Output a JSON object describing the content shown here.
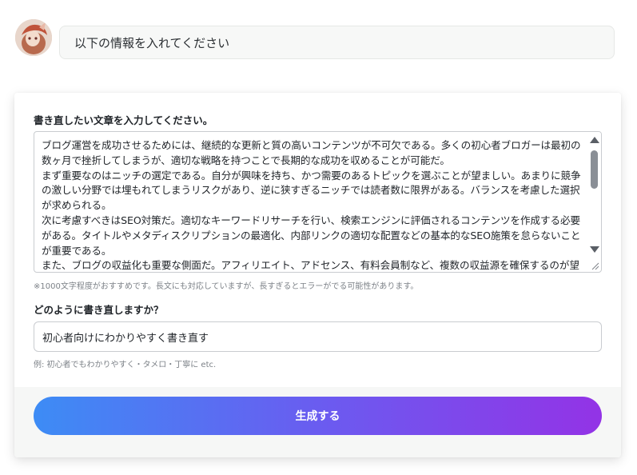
{
  "chat": {
    "user_prompt": "以下の情報を入れてください"
  },
  "form": {
    "article_label": "書き直したい文章を入力してください。",
    "article_text": "ブログ運営を成功させるためには、継続的な更新と質の高いコンテンツが不可欠である。多くの初心者ブロガーは最初の数ヶ月で挫折してしまうが、適切な戦略を持つことで長期的な成功を収めることが可能だ。\nまず重要なのはニッチの選定である。自分が興味を持ち、かつ需要のあるトピックを選ぶことが望ましい。あまりに競争の激しい分野では埋もれてしまうリスクがあり、逆に狭すぎるニッチでは読者数に限界がある。バランスを考慮した選択が求められる。\n次に考慮すべきはSEO対策だ。適切なキーワードリサーチを行い、検索エンジンに評価されるコンテンツを作成する必要がある。タイトルやメタディスクリプションの最適化、内部リンクの適切な配置などの基本的なSEO施策を怠らないことが重要である。\nまた、ブログの収益化も重要な側面だ。アフィリエイト、アドセンス、有料会員制など、複数の収益源を確保するのが望ましい。単一の収益源に依存すると、アルゴリズムの変更や市場の変動によって収入が不安定になるリスクがある。\nコンテンツの質を保つためには、定期的な調査とリサーチが必要だ。自分の専門知識に加え、最新の情報や統計データを取り",
    "article_hint": "※1000文字程度がおすすめです。長文にも対応していますが、長すぎるとエラーがでる可能性があります。",
    "style_label": "どのように書き直しますか？",
    "style_value": "初心者向けにわかりやすく書き直す",
    "style_hint": "例: 初心者でもわかりやすく・タメロ・丁寧に etc.",
    "generate_label": "生成する"
  },
  "icons": {
    "avatar": "user-avatar",
    "scroll_up": "scroll-up-arrow-icon",
    "scroll_down": "scroll-down-arrow-icon",
    "resize": "resize-grip-icon"
  },
  "colors": {
    "button_gradient_start": "#3d8cf5",
    "button_gradient_end": "#9333e6",
    "footer_bg": "#f6f7f6"
  }
}
